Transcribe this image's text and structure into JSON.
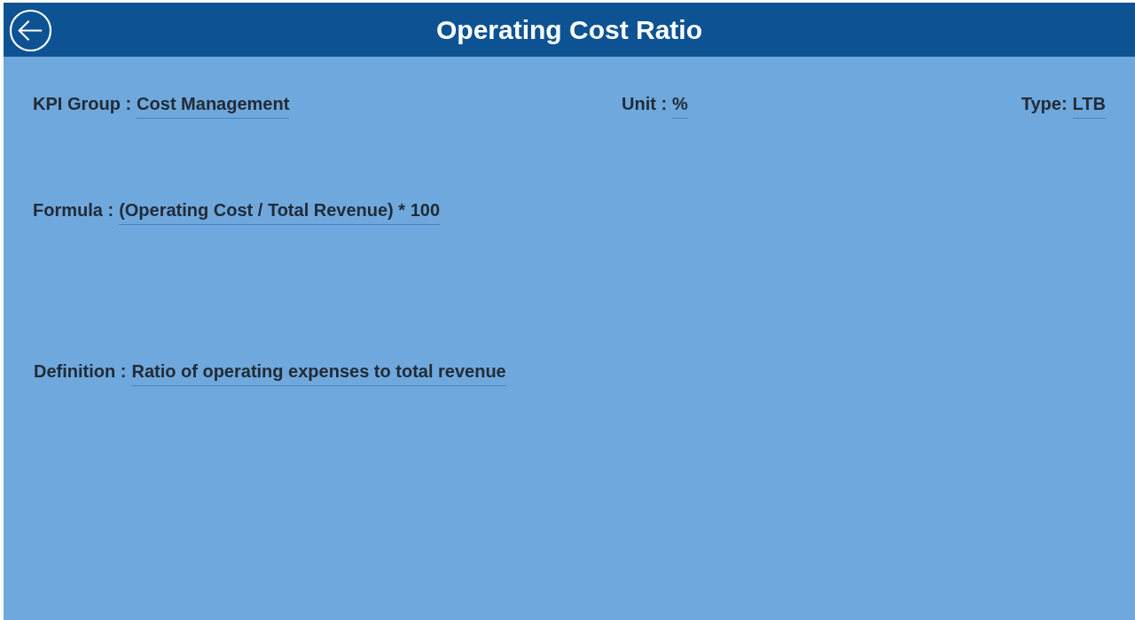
{
  "header": {
    "title": "Operating Cost Ratio"
  },
  "rows": [
    [
      {
        "label": "KPI Group :",
        "value": "Cost Management"
      },
      {
        "label": "Unit :",
        "value": "%"
      },
      {
        "label": "Type:",
        "value": "LTB"
      }
    ],
    [
      {
        "label": "Formula :",
        "value": "(Operating Cost / Total Revenue) * 100"
      }
    ],
    [
      {
        "label": "Definition :",
        "value": "Ratio of operating expenses to total revenue"
      }
    ]
  ]
}
